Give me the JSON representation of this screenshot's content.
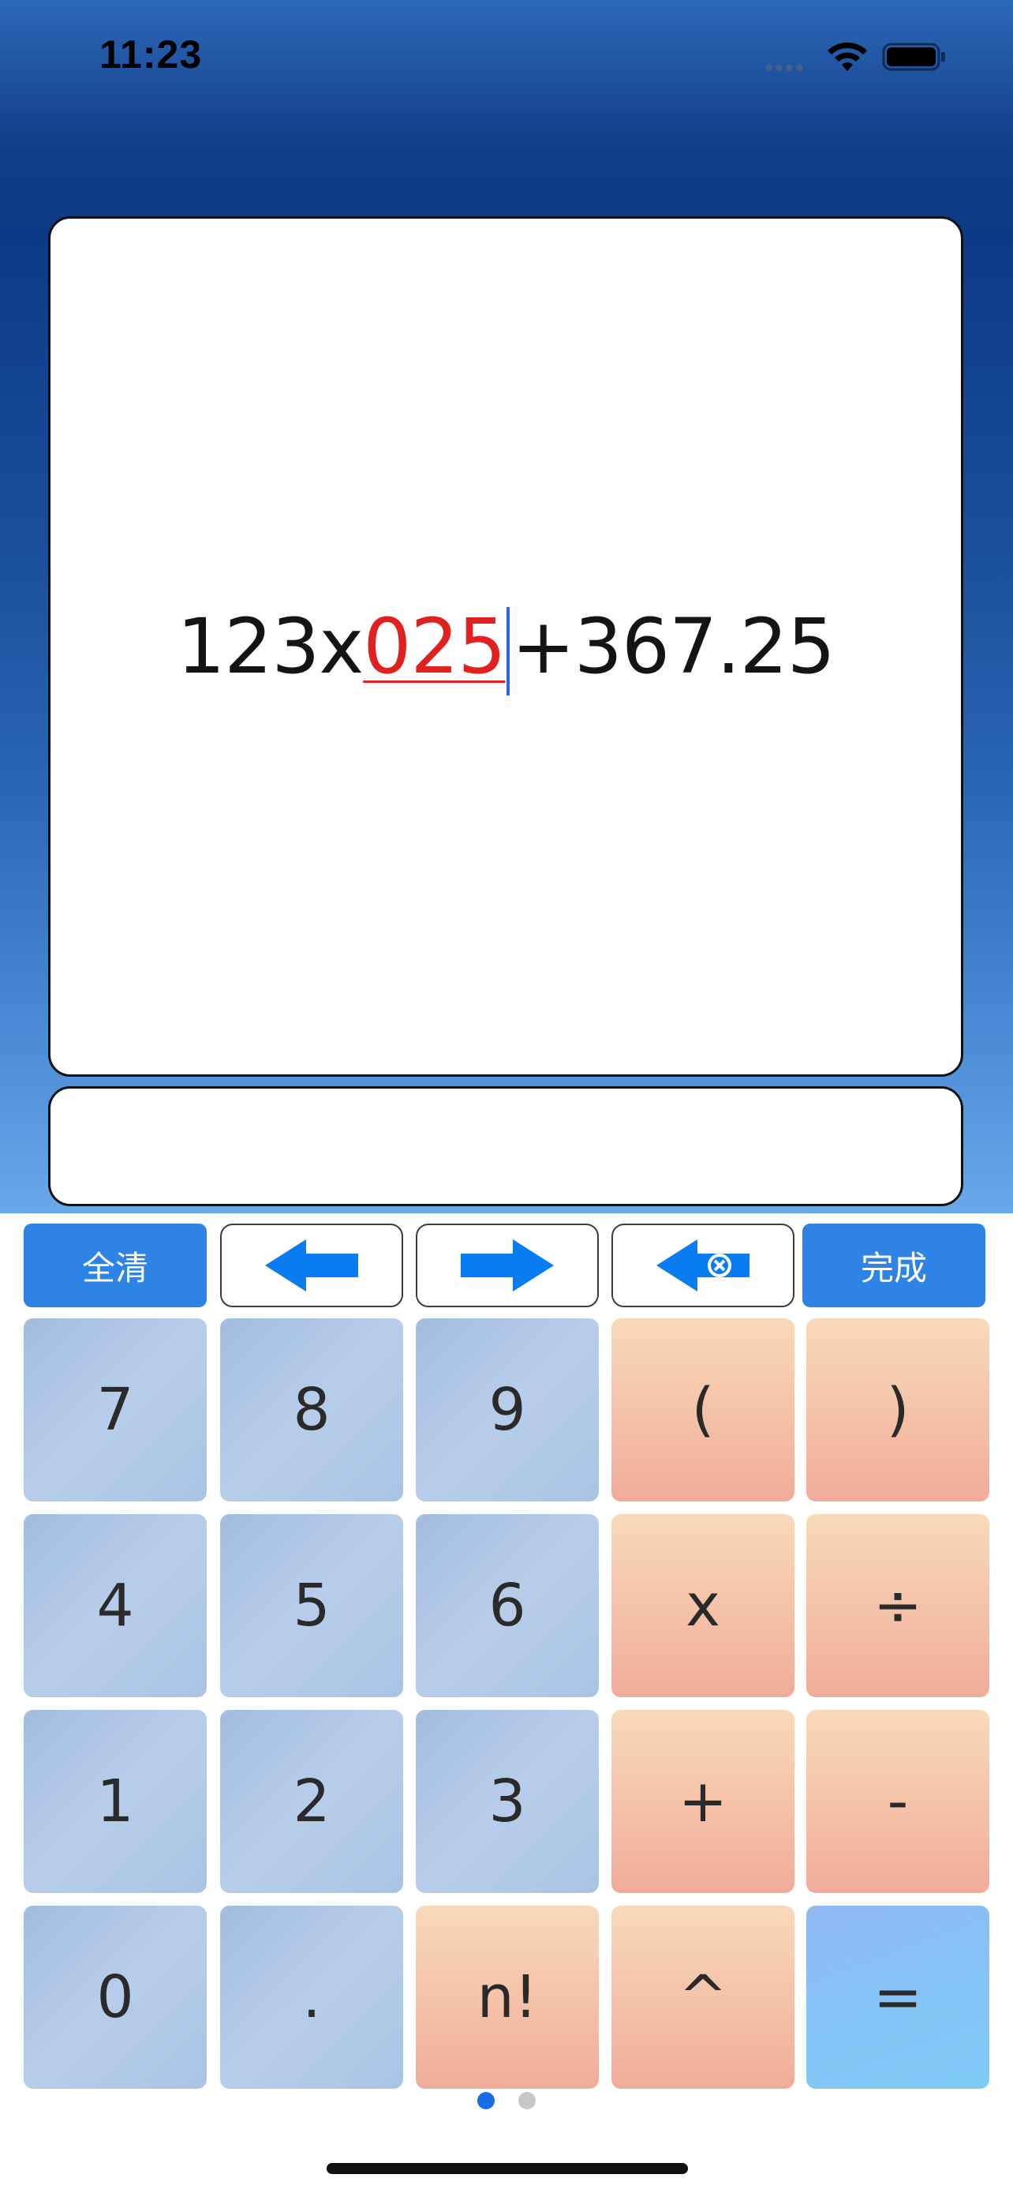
{
  "status_bar": {
    "time": "11:23",
    "icons": [
      "signal-icon",
      "wifi-icon",
      "battery-icon"
    ]
  },
  "display": {
    "expression_before": "123x",
    "expression_active": "025",
    "expression_after": "+367.25",
    "result": "",
    "active_color": "#e0211f",
    "cursor_color": "#2e63e8"
  },
  "controls": {
    "clear_label": "全清",
    "done_label": "完成",
    "left_arrow": "arrow-left-icon",
    "right_arrow": "arrow-right-icon",
    "backspace": "backspace-icon",
    "accent_color": "#2d84e4"
  },
  "keys": {
    "k7": "7",
    "k8": "8",
    "k9": "9",
    "lparen": "(",
    "rparen": ")",
    "k4": "4",
    "k5": "5",
    "k6": "6",
    "times": "x",
    "divide": "÷",
    "k1": "1",
    "k2": "2",
    "k3": "3",
    "plus": "+",
    "minus": "-",
    "k0": "0",
    "dot": ".",
    "factorial": "n!",
    "power": "^",
    "equals": "="
  },
  "pager": {
    "page_count": 2,
    "active_page": 1,
    "active_color": "#1a6ce8",
    "inactive_color": "#c7c7c7"
  }
}
